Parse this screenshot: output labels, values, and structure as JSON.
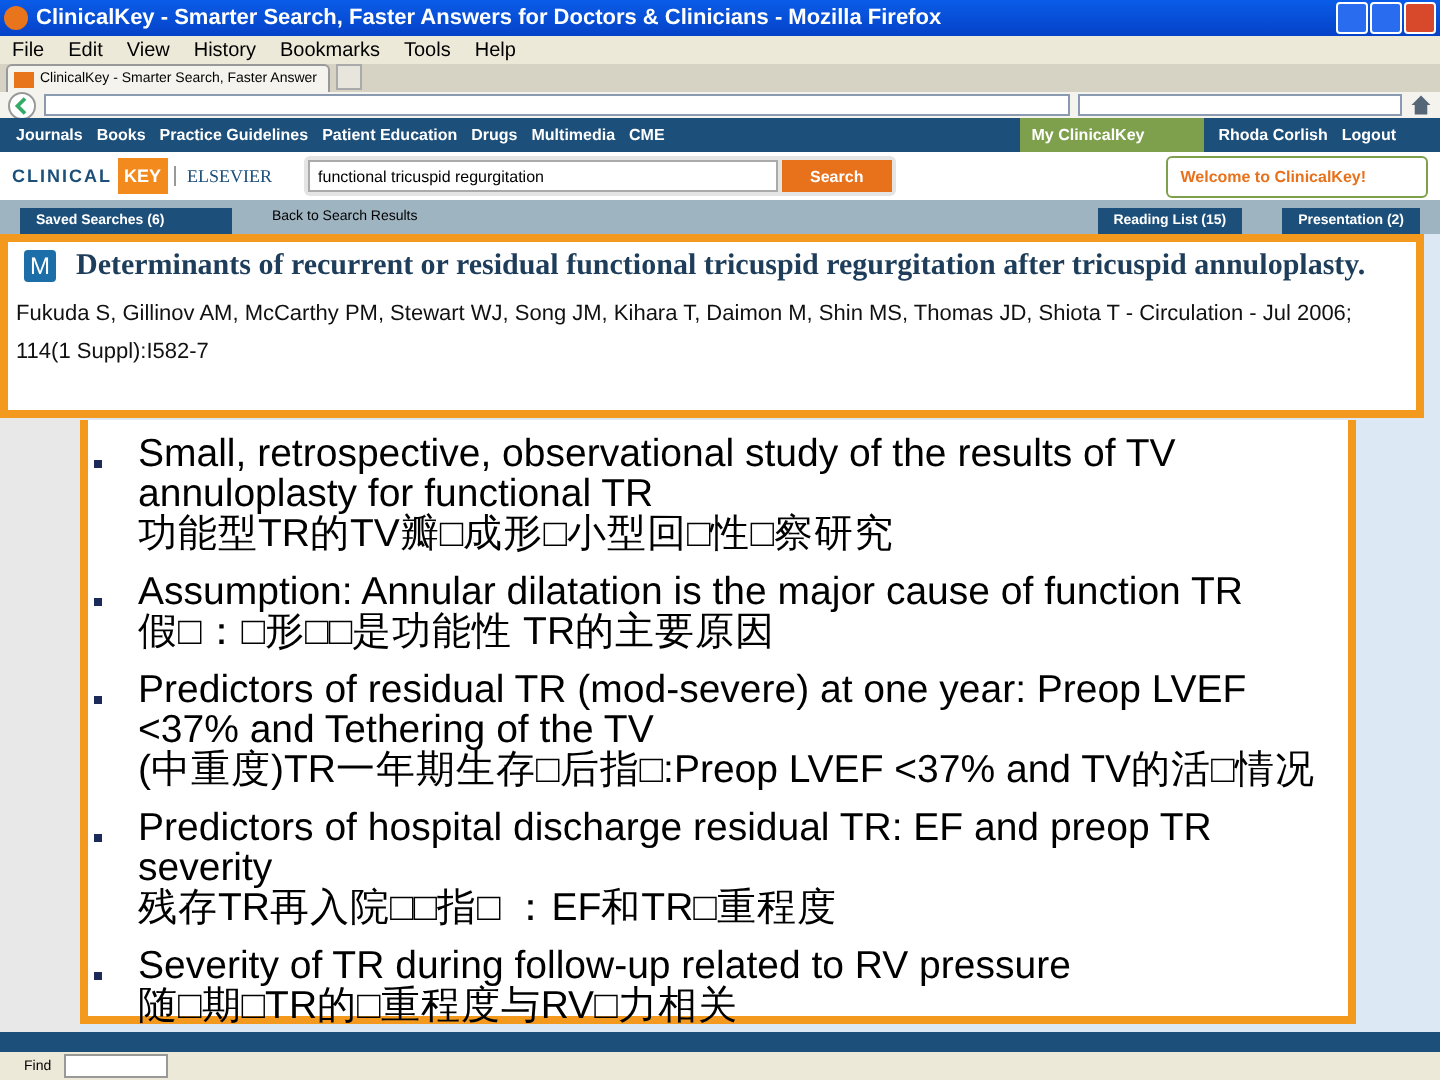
{
  "window": {
    "title": "ClinicalKey - Smarter Search, Faster Answers for Doctors & Clinicians - Mozilla Firefox"
  },
  "menu": [
    "File",
    "Edit",
    "View",
    "History",
    "Bookmarks",
    "Tools",
    "Help"
  ],
  "tabs": [
    {
      "label": "ClinicalKey - Smarter Search, Faster Answer",
      "selected": true
    }
  ],
  "site_nav": {
    "links": [
      "Journals",
      "Books",
      "Practice Guidelines",
      "Patient Education",
      "Drugs",
      "Multimedia",
      "CME"
    ],
    "my_clinicalkey": "My ClinicalKey",
    "user": "Rhoda Corlish",
    "logout": "Logout"
  },
  "header": {
    "logo_clinical": "CLINICAL",
    "logo_key": "KEY",
    "publisher": "ELSEVIER",
    "search_value": "functional tricuspid regurgitation",
    "search_button": "Search",
    "welcome": "Welcome to ClinicalKey!"
  },
  "toolbar": {
    "saved_searches": "Saved Searches (6)",
    "back": "Back to Search Results",
    "reading_list": "Reading List (15)",
    "presentation": "Presentation (2)"
  },
  "article": {
    "badge": "M",
    "title": "Determinants of recurrent or residual functional tricuspid regurgitation after tricuspid annuloplasty.",
    "citation": "Fukuda S, Gillinov AM, McCarthy PM, Stewart WJ, Song JM, Kihara T, Daimon M, Shin MS, Thomas JD, Shiota T - Circulation - Jul 2006; 114(1 Suppl):I582-7"
  },
  "bullets": [
    {
      "text": "Small, retrospective, observational study of the results of TV annuloplasty for functional TR",
      "translation": "功能型TR的TV瓣□成形□小型回□性□察研究"
    },
    {
      "text": "Assumption: Annular dilatation is the major cause of function TR",
      "translation": "假□：□形□□是功能性 TR的主要原因"
    },
    {
      "text": "Predictors of residual TR (mod-severe) at one year: Preop LVEF <37% and Tethering of the TV",
      "translation": "(中重度)TR一年期生存□后指□:Preop LVEF <37% and TV的活□情况"
    },
    {
      "text": "Predictors of hospital discharge residual TR: EF and preop TR severity",
      "translation": "残存TR再入院□□指□ ：EF和TR□重程度"
    },
    {
      "text": "Severity of TR during follow-up related to RV pressure",
      "translation": "随□期□TR的□重程度与RV□力相关"
    }
  ],
  "find_bar": {
    "label": "Find"
  }
}
